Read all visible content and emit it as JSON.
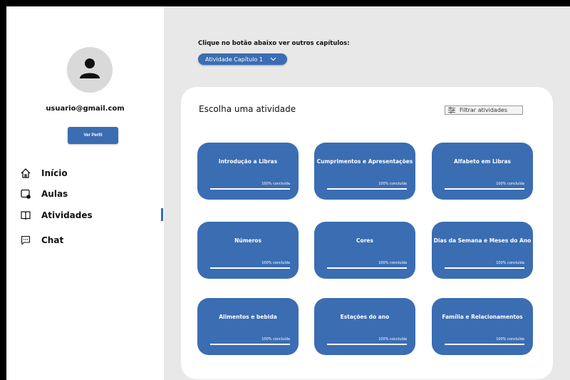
{
  "sidebar": {
    "email": "usuario@gmail.com",
    "profile_button": "Ver Perfil",
    "nav": [
      {
        "label": "Início",
        "icon": "home-icon"
      },
      {
        "label": "Aulas",
        "icon": "video-lessons-icon"
      },
      {
        "label": "Atividades",
        "icon": "book-icon",
        "active": true
      },
      {
        "label": "Chat",
        "icon": "chat-icon"
      }
    ]
  },
  "main": {
    "prompt": "Clique no botão abaixo ver outros capítulos:",
    "chapter_select": "Atividade Capítulo 1",
    "panel_title": "Escolha uma atividade",
    "filter_label": "Filtrar atividades",
    "activities": [
      {
        "name": "Introdução a Libras",
        "progress": "100% concluída"
      },
      {
        "name": "Cumprimentos e Apresentações",
        "progress": "100% concluída"
      },
      {
        "name": "Alfabeto em Libras",
        "progress": "100% concluída"
      },
      {
        "name": "Números",
        "progress": "100% concluída"
      },
      {
        "name": "Cores",
        "progress": "100% concluída"
      },
      {
        "name": "Dias da Semana e Meses do Ano",
        "progress": "100% concluída"
      },
      {
        "name": "Alimentos e bebida",
        "progress": "100% concluída"
      },
      {
        "name": "Estações do ano",
        "progress": "100% concluída"
      },
      {
        "name": "Família e Relacionamentos",
        "progress": "100% concluída"
      }
    ]
  },
  "colors": {
    "accent": "#3b6db3",
    "background": "#e8e8e8"
  }
}
